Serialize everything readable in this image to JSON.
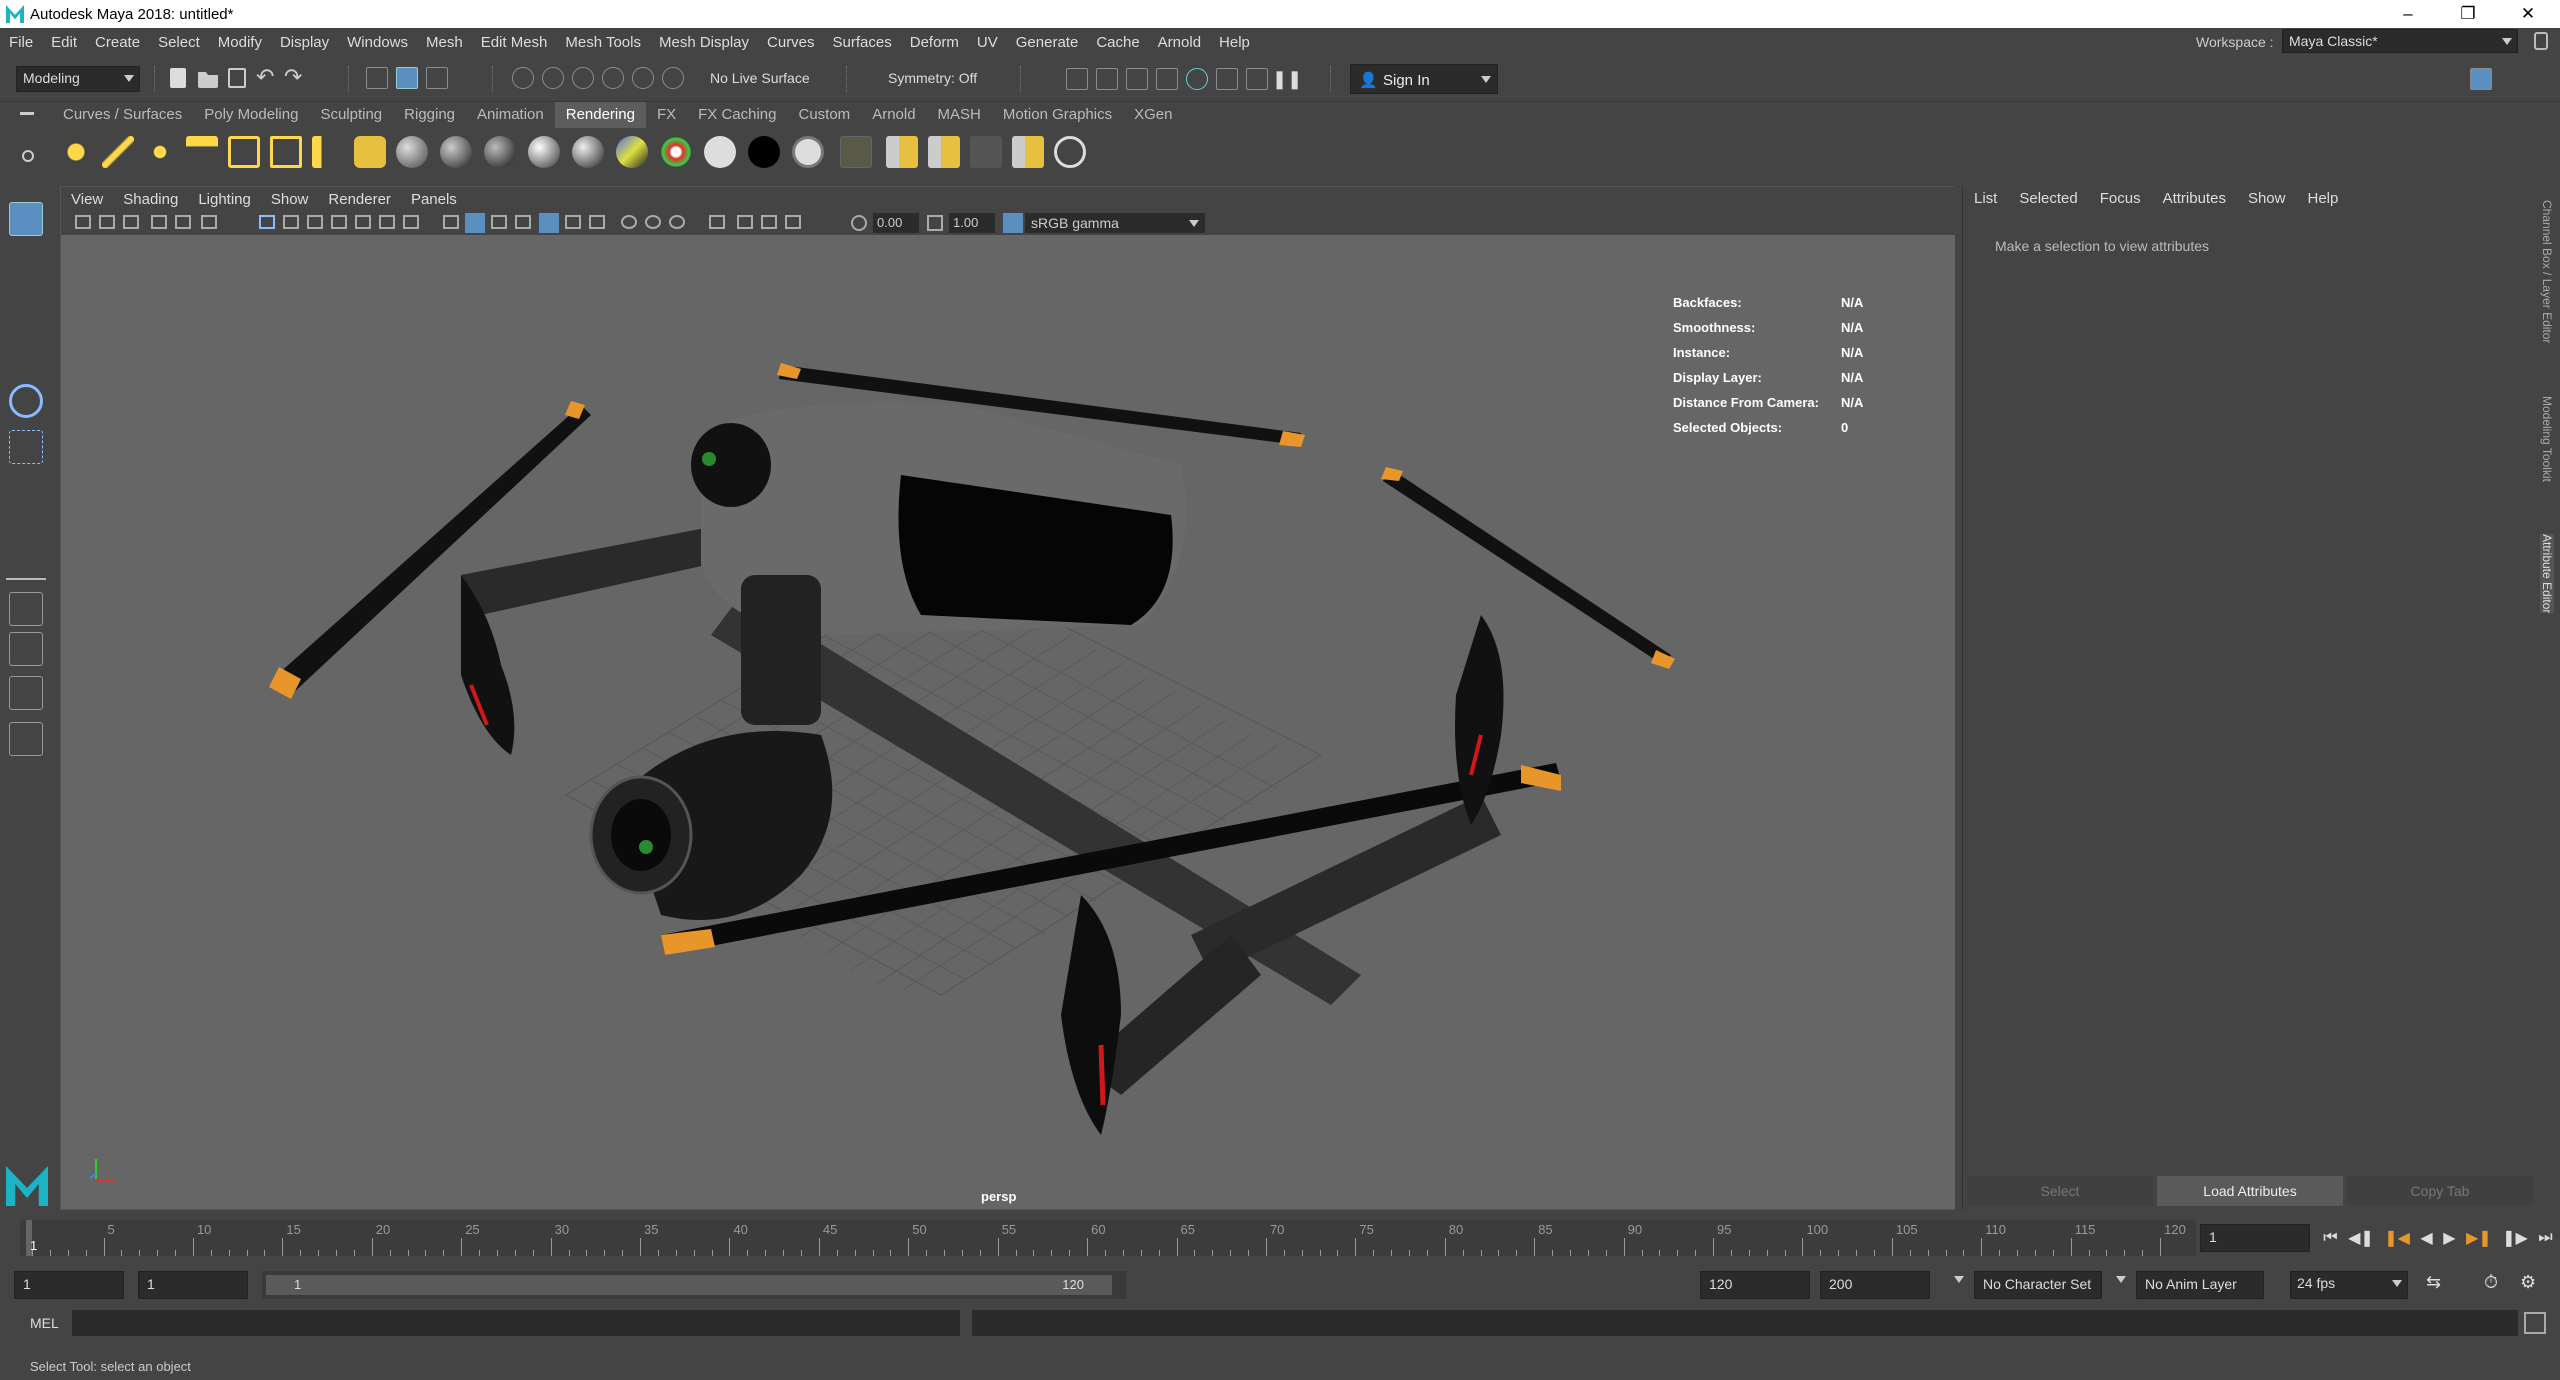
{
  "window": {
    "title": "Autodesk Maya 2018: untitled*"
  },
  "menu": [
    "File",
    "Edit",
    "Create",
    "Select",
    "Modify",
    "Display",
    "Windows",
    "Mesh",
    "Edit Mesh",
    "Mesh Tools",
    "Mesh Display",
    "Curves",
    "Surfaces",
    "Deform",
    "UV",
    "Generate",
    "Cache",
    "Arnold",
    "Help"
  ],
  "workspace": {
    "label": "Workspace :",
    "value": "Maya Classic*"
  },
  "status_line": {
    "menuset": "Modeling",
    "live_surface": "No Live Surface",
    "symmetry": "Symmetry: Off",
    "sign_in": "Sign In"
  },
  "shelf_tabs": [
    "Curves / Surfaces",
    "Poly Modeling",
    "Sculpting",
    "Rigging",
    "Animation",
    "Rendering",
    "FX",
    "FX Caching",
    "Custom",
    "Arnold",
    "MASH",
    "Motion Graphics",
    "XGen"
  ],
  "active_shelf_tab": "Rendering",
  "viewport": {
    "menu": [
      "View",
      "Shading",
      "Lighting",
      "Show",
      "Renderer",
      "Panels"
    ],
    "exposure": "0.00",
    "gamma": "1.00",
    "color_space": "sRGB gamma",
    "camera": "persp",
    "hud": [
      {
        "key": "Backfaces:",
        "value": "N/A"
      },
      {
        "key": "Smoothness:",
        "value": "N/A"
      },
      {
        "key": "Instance:",
        "value": "N/A"
      },
      {
        "key": "Display Layer:",
        "value": "N/A"
      },
      {
        "key": "Distance From Camera:",
        "value": "N/A"
      },
      {
        "key": "Selected Objects:",
        "value": "0"
      }
    ]
  },
  "attribute_editor": {
    "menu": [
      "List",
      "Selected",
      "Focus",
      "Attributes",
      "Show",
      "Help"
    ],
    "message": "Make a selection to view attributes",
    "buttons": {
      "select": "Select",
      "load": "Load Attributes",
      "copy": "Copy Tab"
    }
  },
  "side_tabs": [
    "Channel Box / Layer Editor",
    "Modeling Toolkit",
    "Attribute Editor"
  ],
  "time_slider": {
    "labels": [
      "5",
      "10",
      "15",
      "20",
      "25",
      "30",
      "35",
      "40",
      "45",
      "50",
      "55",
      "60",
      "65",
      "70",
      "75",
      "80",
      "85",
      "90",
      "95",
      "100",
      "105",
      "110",
      "115",
      "120"
    ],
    "current_frame": "1",
    "frame_field": "1"
  },
  "range_slider": {
    "start": "1",
    "playback_start": "1",
    "range_start": "1",
    "range_end": "120",
    "playback_end": "120",
    "end": "200",
    "character_set": "No Character Set",
    "anim_layer": "No Anim Layer",
    "fps": "24 fps"
  },
  "command_line": {
    "label": "MEL"
  },
  "help_line": "Select Tool: select an object",
  "colors": {
    "accent_orange": "#e8962a",
    "bg": "#444444",
    "viewport": "#666666"
  }
}
